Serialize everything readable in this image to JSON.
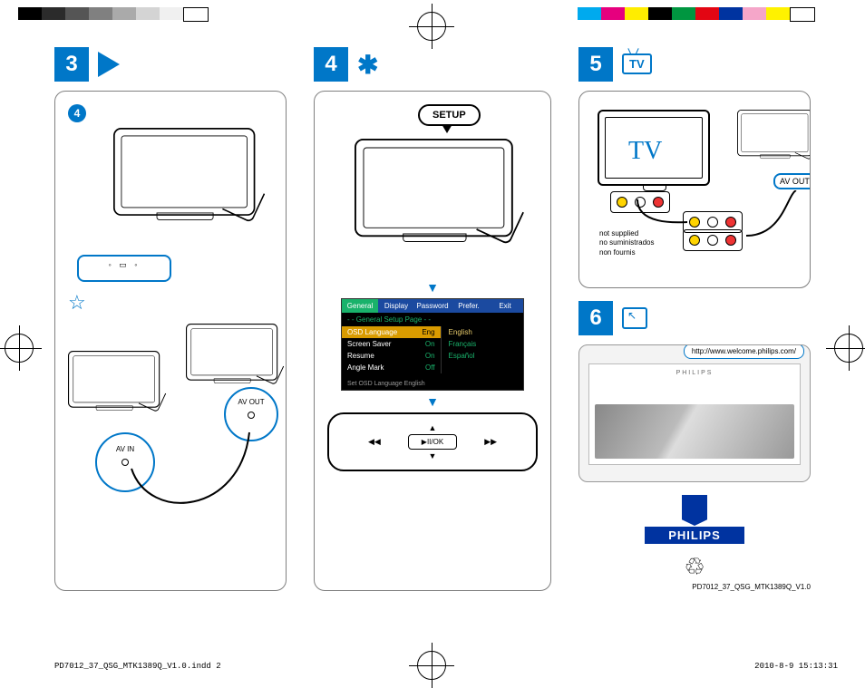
{
  "steps": {
    "s3": {
      "num": "3",
      "badge": "4"
    },
    "s4": {
      "num": "4",
      "setup_btn": "SETUP"
    },
    "s5": {
      "num": "5",
      "tv_label": "TV",
      "tv_screen": "TV"
    },
    "s6": {
      "num": "6"
    }
  },
  "av_labels": {
    "in": "AV IN",
    "out": "AV OUT"
  },
  "not_supplied": {
    "en": "not supplied",
    "es": "no suministrados",
    "fr": "non fournis"
  },
  "menu": {
    "tabs": [
      "General",
      "Display",
      "Password",
      "Prefer.",
      "Exit"
    ],
    "title": "- - General Setup Page - -",
    "rows": [
      {
        "label": "OSD Language",
        "value": "Eng",
        "highlight": true
      },
      {
        "label": "Screen Saver",
        "value": "On"
      },
      {
        "label": "Resume",
        "value": "On"
      },
      {
        "label": "Angle Mark",
        "value": "Off"
      }
    ],
    "options": [
      "English",
      "Français",
      "Español"
    ],
    "status": "Set OSD Language English"
  },
  "navpad": {
    "left": "◀◀",
    "right": "▶▶",
    "up": "▲",
    "down": "▼",
    "center": "▶II/OK"
  },
  "web": {
    "url": "http://www.welcome.philips.com/"
  },
  "brand": "PHILIPS",
  "doc_id": "PD7012_37_QSG_MTK1389Q_V1.0",
  "footer": {
    "file": "PD7012_37_QSG_MTK1389Q_V1.0.indd   2",
    "ts": "2010-8-9   15:13:31"
  },
  "colors": {
    "left_bar": [
      "#000000",
      "#2b2b2b",
      "#555555",
      "#808080",
      "#aaaaaa",
      "#d4d4d4",
      "#f0f0f0",
      "#ffffff"
    ],
    "right_bar": [
      "#00aaee",
      "#e6007e",
      "#ffed00",
      "#000000",
      "#009640",
      "#e30613",
      "#0033a0",
      "#f5a6c9",
      "#fff200",
      "#ffffff"
    ]
  }
}
